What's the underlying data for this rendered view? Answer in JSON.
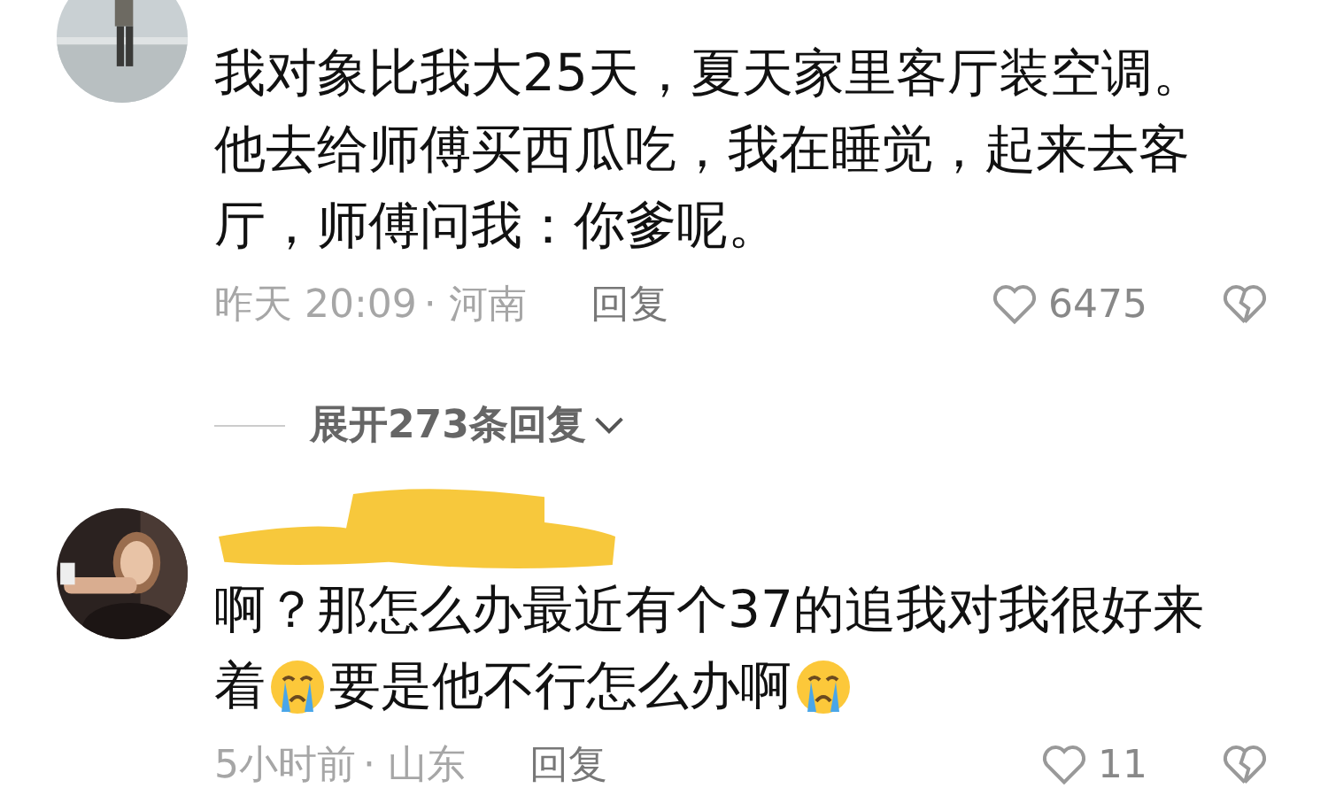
{
  "comments": [
    {
      "avatar": {
        "kind": "picture"
      },
      "redacted_name": false,
      "lines": [
        [
          {
            "kind": "text",
            "text": "我对象比我大25天，夏天家里客厅装空调。"
          }
        ],
        [
          {
            "kind": "text",
            "text": "他去给师傅买西瓜吃，我在睡觉，起来去客"
          }
        ],
        [
          {
            "kind": "text",
            "text": "厅，师傅问我：你爹呢。"
          }
        ]
      ],
      "time": "昨天 20:09",
      "location": "· 河南",
      "reply": "回复",
      "likes": "6475",
      "liked": false,
      "expand": "展开273条回复"
    },
    {
      "avatar": {
        "kind": "picture"
      },
      "redacted_name": true,
      "lines": [
        [
          {
            "kind": "text",
            "text": "啊？那怎么办最近有个37的追我对我很好来"
          }
        ],
        [
          {
            "kind": "text",
            "text": "着"
          },
          {
            "kind": "emoji"
          },
          {
            "kind": "text",
            "text": "要是他不行怎么办啊"
          },
          {
            "kind": "emoji"
          }
        ]
      ],
      "time": "5小时前",
      "location": "· 山东",
      "reply": "回复",
      "likes": "11",
      "liked": false
    }
  ]
}
